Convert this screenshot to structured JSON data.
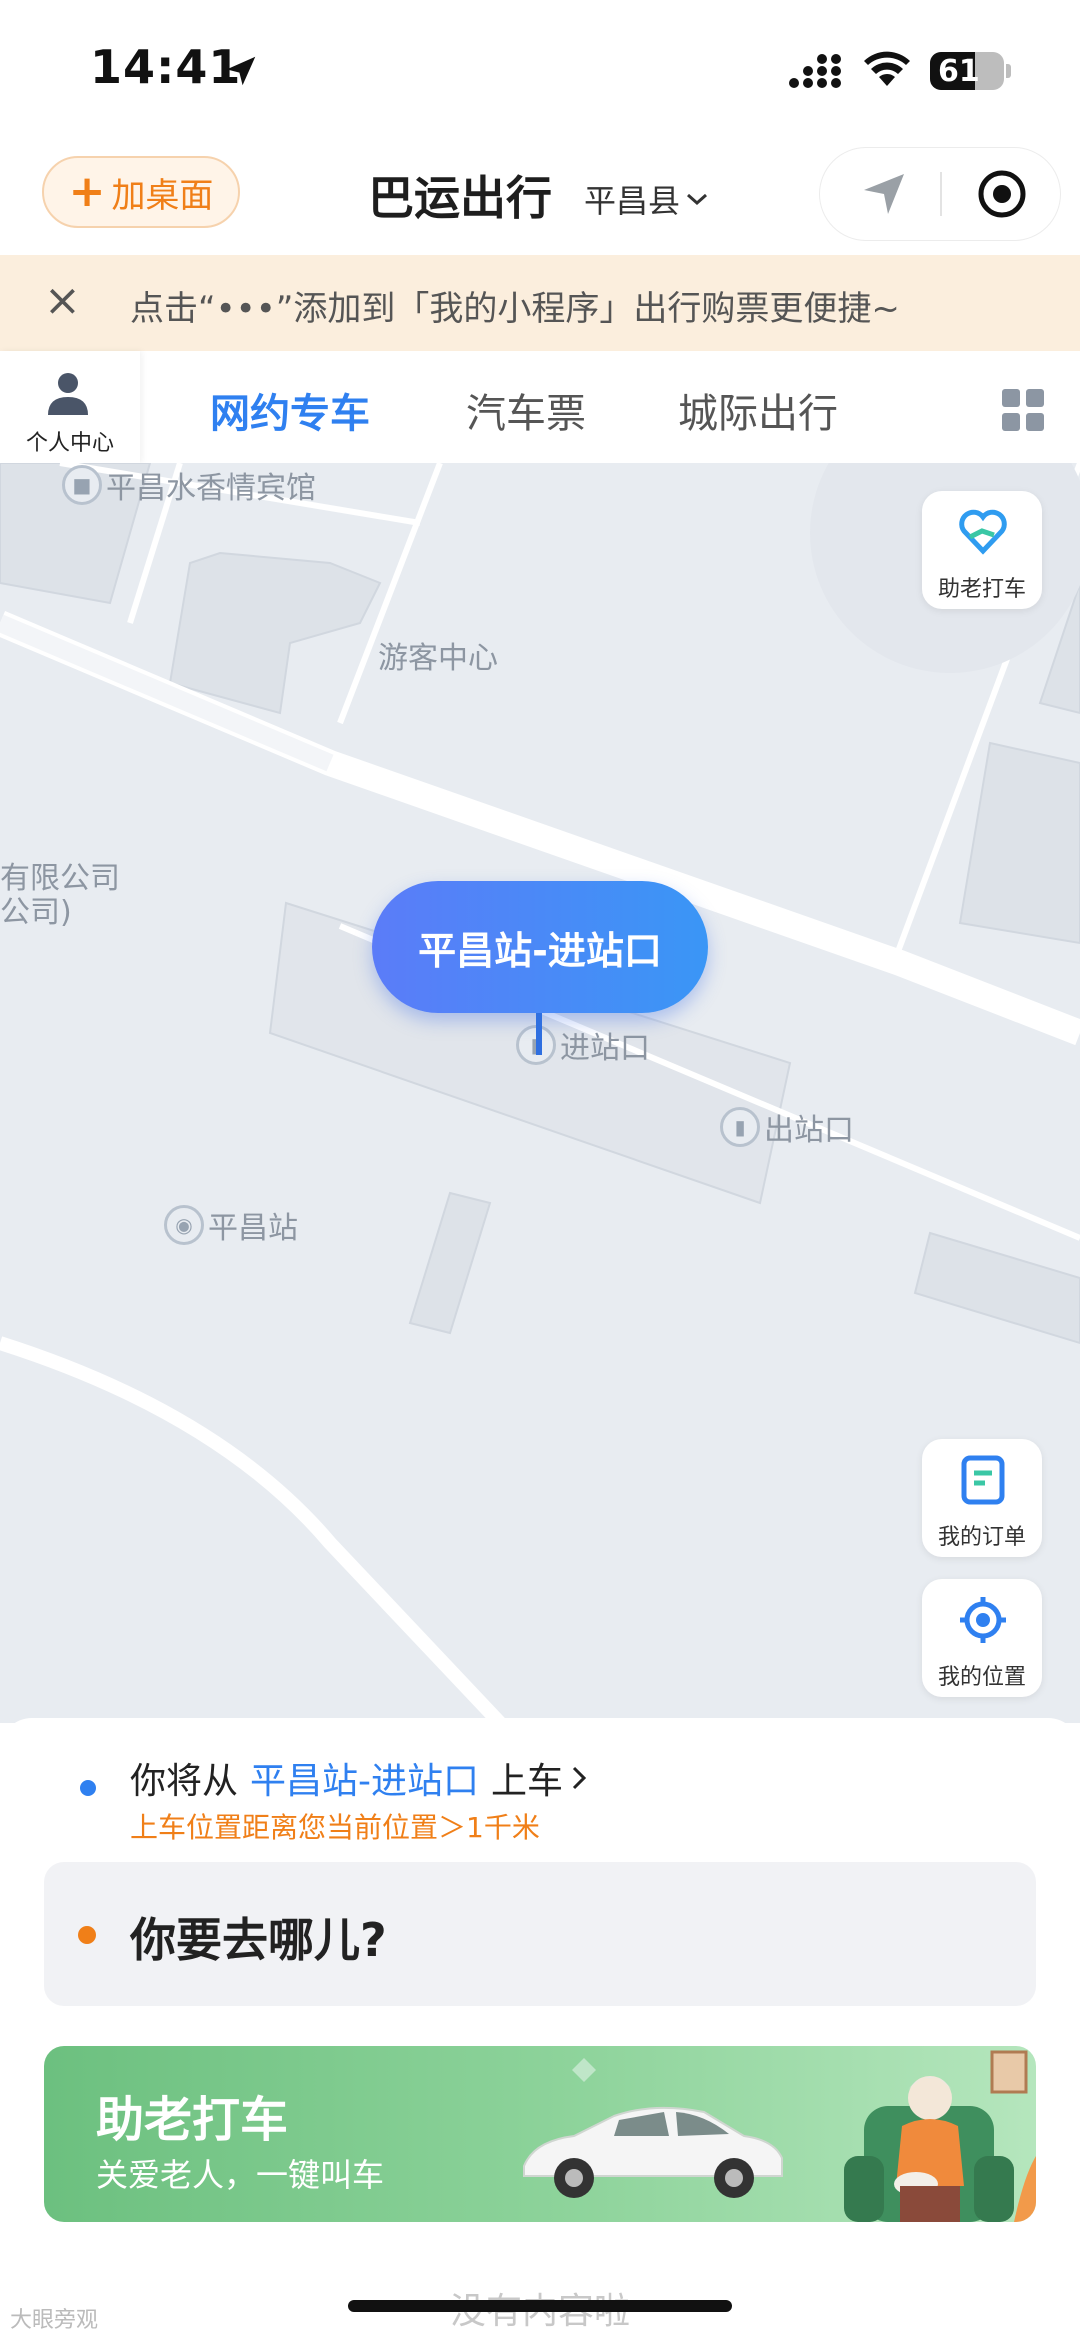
{
  "status_bar": {
    "time": "14:41",
    "battery": "61",
    "battery_level": 0.61
  },
  "header": {
    "add_desktop_plus": "+",
    "add_desktop_label": "加桌面",
    "title": "巴运出行",
    "region": "平昌县"
  },
  "banner": {
    "close": "×",
    "text": "点击“•••”添加到「我的小程序」出行购票更便捷~"
  },
  "tabs": {
    "profile_label": "个人中心",
    "items": [
      "网约专车",
      "汽车票",
      "城际出行"
    ],
    "active_index": 0
  },
  "map": {
    "labels": {
      "hotel": "平昌水香情宾馆",
      "visitor_center": "游客中心",
      "company_1": "有限公司",
      "company_2": "公司)",
      "entrance": "进站口",
      "exit": "出站口",
      "station": "平昌站"
    },
    "pickup_point": "平昌站-进站口",
    "elderly_button": "助老打车",
    "orders_button": "我的订单",
    "location_button": "我的位置"
  },
  "sheet": {
    "from_prefix": "你将从",
    "from_station": "平昌站-进站口",
    "from_suffix": "上车",
    "distance_warning": "上车位置距离您当前位置＞1千米",
    "destination_placeholder": "你要去哪儿?",
    "promo_title": "助老打车",
    "promo_subtitle": "关爱老人，一键叫车",
    "no_more": "没有内容啦"
  },
  "watermark": "大眼旁观",
  "colors": {
    "accent": "#2f80f0",
    "orange": "#f07f18",
    "map_bg": "#e8ecf1",
    "promo_green": "#6cc07f"
  }
}
